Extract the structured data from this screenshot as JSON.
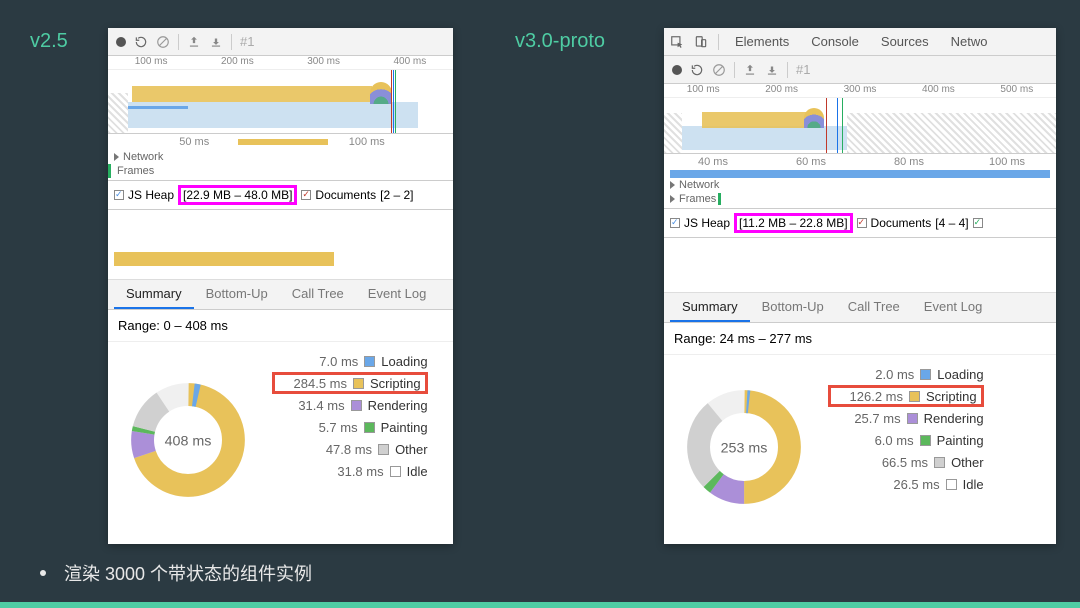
{
  "labels": {
    "v25": "v2.5",
    "v30": "v3.0-proto"
  },
  "devtools_tabs": {
    "elements": "Elements",
    "console": "Console",
    "sources": "Sources",
    "network": "Netwo"
  },
  "toolbar": {
    "hash": "#1"
  },
  "left": {
    "ruler_top": [
      "100 ms",
      "200 ms",
      "300 ms",
      "400 ms"
    ],
    "ruler_sub": [
      "50 ms",
      "100 ms"
    ],
    "network": "Network",
    "frames": "Frames",
    "heap_label": "JS Heap",
    "heap_value": "[22.9 MB – 48.0 MB]",
    "docs_label": "Documents",
    "docs_value": "[2 – 2]",
    "tabs": {
      "summary": "Summary",
      "bottomup": "Bottom-Up",
      "calltree": "Call Tree",
      "eventlog": "Event Log"
    },
    "range": "Range: 0 – 408 ms",
    "center_ms": "408 ms",
    "legend": {
      "loading": {
        "ms": "7.0 ms",
        "label": "Loading",
        "color": "#6aa7e8"
      },
      "scripting": {
        "ms": "284.5 ms",
        "label": "Scripting",
        "color": "#e8c25a"
      },
      "rendering": {
        "ms": "31.4 ms",
        "label": "Rendering",
        "color": "#ab8fd8"
      },
      "painting": {
        "ms": "5.7 ms",
        "label": "Painting",
        "color": "#5cb85c"
      },
      "other": {
        "ms": "47.8 ms",
        "label": "Other",
        "color": "#d0d0d0"
      },
      "idle": {
        "ms": "31.8 ms",
        "label": "Idle",
        "color": "#ffffff"
      }
    }
  },
  "right": {
    "ruler_top": [
      "100 ms",
      "200 ms",
      "300 ms",
      "400 ms",
      "500 ms"
    ],
    "ruler_sub": [
      "40 ms",
      "60 ms",
      "80 ms",
      "100 ms"
    ],
    "network": "Network",
    "frames": "Frames",
    "heap_label": "JS Heap",
    "heap_value": "[11.2 MB – 22.8 MB]",
    "docs_label": "Documents",
    "docs_value": "[4 – 4]",
    "tabs": {
      "summary": "Summary",
      "bottomup": "Bottom-Up",
      "calltree": "Call Tree",
      "eventlog": "Event Log"
    },
    "range": "Range: 24 ms – 277 ms",
    "center_ms": "253 ms",
    "legend": {
      "loading": {
        "ms": "2.0 ms",
        "label": "Loading",
        "color": "#6aa7e8"
      },
      "scripting": {
        "ms": "126.2 ms",
        "label": "Scripting",
        "color": "#e8c25a"
      },
      "rendering": {
        "ms": "25.7 ms",
        "label": "Rendering",
        "color": "#ab8fd8"
      },
      "painting": {
        "ms": "6.0 ms",
        "label": "Painting",
        "color": "#5cb85c"
      },
      "other": {
        "ms": "66.5 ms",
        "label": "Other",
        "color": "#d0d0d0"
      },
      "idle": {
        "ms": "26.5 ms",
        "label": "Idle",
        "color": "#ffffff"
      }
    }
  },
  "chart_data": [
    {
      "type": "pie",
      "title": "v2.5 Summary 408 ms",
      "categories": [
        "Loading",
        "Scripting",
        "Rendering",
        "Painting",
        "Other",
        "Idle"
      ],
      "values": [
        7.0,
        284.5,
        31.4,
        5.7,
        47.8,
        31.8
      ]
    },
    {
      "type": "pie",
      "title": "v3.0-proto Summary 253 ms",
      "categories": [
        "Loading",
        "Scripting",
        "Rendering",
        "Painting",
        "Other",
        "Idle"
      ],
      "values": [
        2.0,
        126.2,
        25.7,
        6.0,
        66.5,
        26.5
      ]
    }
  ],
  "caption": "渲染 3000 个带状态的组件实例"
}
